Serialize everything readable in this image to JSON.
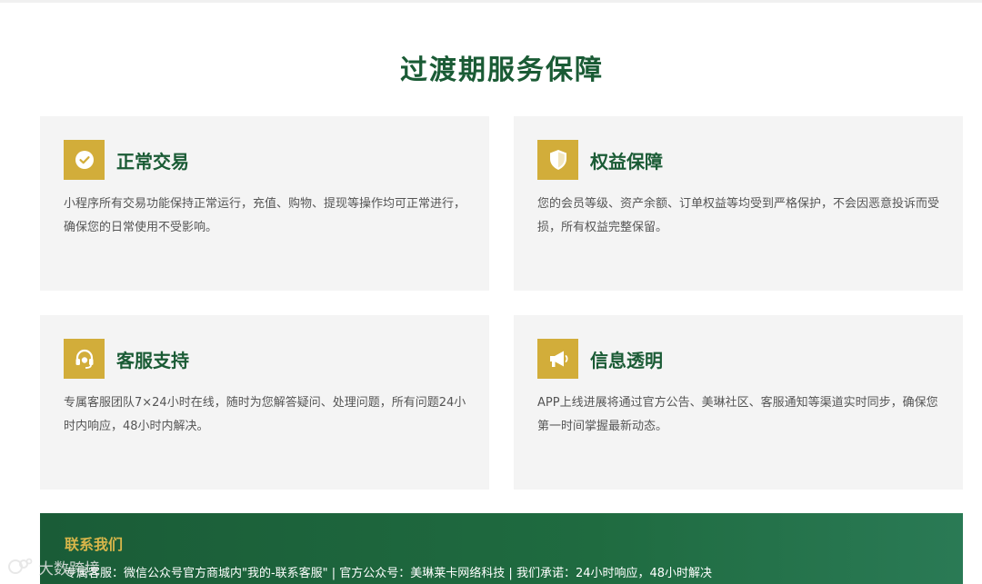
{
  "page": {
    "title": "过渡期服务保障"
  },
  "cards": [
    {
      "title": "正常交易",
      "icon": "check-circle-icon",
      "desc": "小程序所有交易功能保持正常运行，充值、购物、提现等操作均可正常进行，确保您的日常使用不受影响。"
    },
    {
      "title": "权益保障",
      "icon": "shield-icon",
      "desc": "您的会员等级、资产余额、订单权益等均受到严格保护，不会因恶意投诉而受损，所有权益完整保留。"
    },
    {
      "title": "客服支持",
      "icon": "headset-icon",
      "desc": "专属客服团队7×24小时在线，随时为您解答疑问、处理问题，所有问题24小时内响应，48小时内解决。"
    },
    {
      "title": "信息透明",
      "icon": "megaphone-icon",
      "desc": "APP上线进展将通过官方公告、美琳社区、客服通知等渠道实时同步，确保您第一时间掌握最新动态。"
    }
  ],
  "contact": {
    "title": "联系我们",
    "text": "专属客服：微信公众号官方商城内\"我的-联系客服\" | 官方公众号：美琳莱卡网络科技 | 我们承诺：24小时响应，48小时解决"
  },
  "watermark": {
    "text": "大数跨境"
  },
  "colors": {
    "primary_green": "#1a5b35",
    "accent_gold": "#d2ad3a",
    "card_bg": "#f4f4f4"
  }
}
